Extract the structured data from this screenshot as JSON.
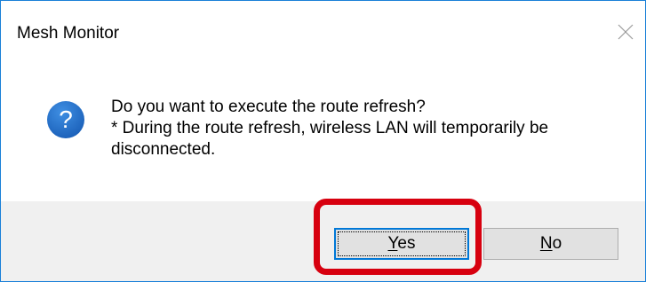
{
  "window": {
    "title": "Mesh Monitor",
    "close_glyph": "close-icon"
  },
  "message": {
    "icon": "question-icon",
    "icon_glyph": "?",
    "line1": "Do you want to execute the route refresh?",
    "line2": "* During the route refresh, wireless LAN will temporarily be",
    "line3": "disconnected."
  },
  "buttons": {
    "yes_mnemonic": "Y",
    "yes_rest": "es",
    "no_mnemonic": "N",
    "no_rest": "o"
  },
  "colors": {
    "window_border": "#1a80d8",
    "icon_blue": "#1f6fcb",
    "button_bar": "#f0f0f0",
    "focus_border": "#0078d7",
    "highlight_red": "#d7000f"
  }
}
